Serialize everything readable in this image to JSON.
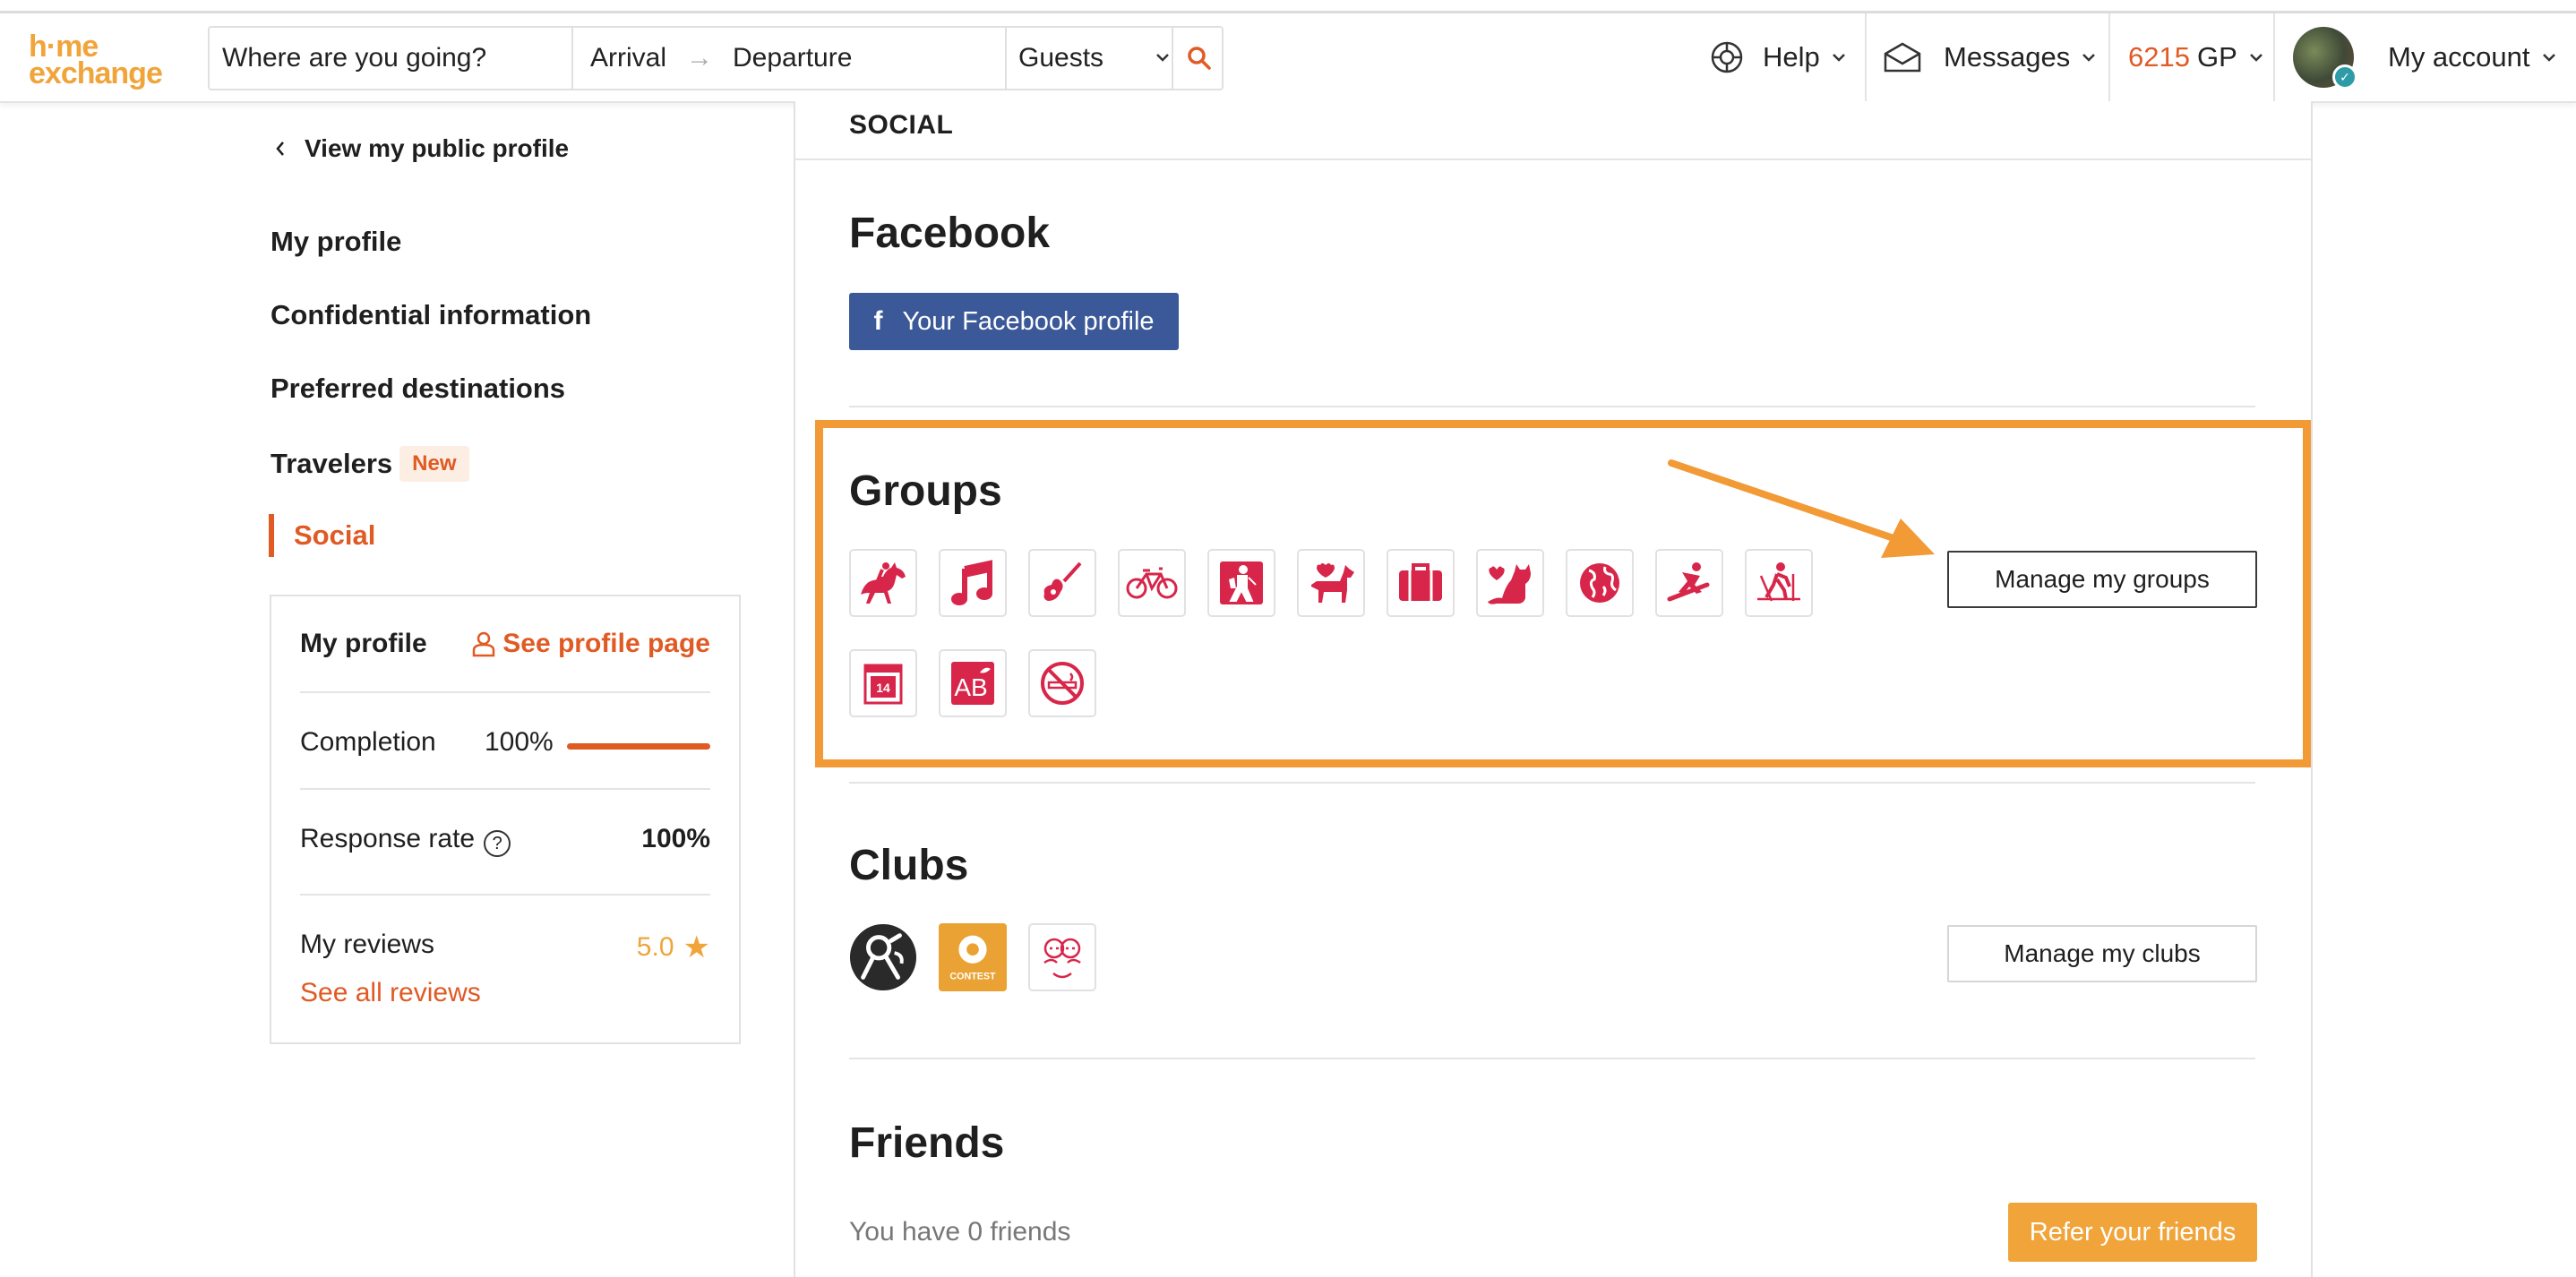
{
  "brand": {
    "logo_line1": "h·me",
    "logo_line2": "exchange",
    "color": "#f0a43a"
  },
  "search": {
    "where_placeholder": "Where are you going?",
    "arrival": "Arrival",
    "arrow": "→",
    "departure": "Departure",
    "guests": "Guests"
  },
  "header_nav": {
    "help": "Help",
    "messages": "Messages",
    "gp_value": "6215",
    "gp_unit": "GP",
    "account": "My account"
  },
  "sidebar": {
    "back_link": "View my public profile",
    "items": [
      {
        "label": "My profile"
      },
      {
        "label": "Confidential information"
      },
      {
        "label": "Preferred destinations"
      },
      {
        "label": "Travelers",
        "badge": "New"
      },
      {
        "label": "Social",
        "active": true
      }
    ]
  },
  "profile_card": {
    "title": "My profile",
    "see_page": "See profile page",
    "completion_label": "Completion",
    "completion_value": "100%",
    "completion_fraction": 1.0,
    "response_label": "Response rate",
    "response_help": "?",
    "response_value": "100%",
    "reviews_label": "My reviews",
    "reviews_score": "5.0",
    "reviews_star": "★",
    "see_all_reviews": "See all reviews"
  },
  "main": {
    "section_title": "SOCIAL",
    "facebook": {
      "heading": "Facebook",
      "button": "Your Facebook profile",
      "icon_letter": "f"
    },
    "groups": {
      "heading": "Groups",
      "manage_button": "Manage my groups",
      "icons": [
        "horse-riding-icon",
        "music-note-icon",
        "guitar-icon",
        "bicycle-icon",
        "hiking-icon",
        "dog-icon",
        "suitcase-icon",
        "cat-icon",
        "globe-icon",
        "snowboard-icon",
        "cross-country-ski-icon",
        "calendar-icon",
        "organic-ab-icon",
        "no-smoking-icon"
      ],
      "calendar_day": "14",
      "organic_text": "AB",
      "icon_color": "#d7264a"
    },
    "clubs": {
      "heading": "Clubs",
      "manage_button": "Manage my clubs",
      "contest_label": "CONTEST"
    },
    "friends": {
      "heading": "Friends",
      "count_text": "You have 0 friends",
      "refer_button": "Refer your friends"
    }
  },
  "colors": {
    "accent": "#e05a24",
    "annotation": "#f29a36",
    "facebook": "#3b5998",
    "refer": "#f0a43a"
  }
}
